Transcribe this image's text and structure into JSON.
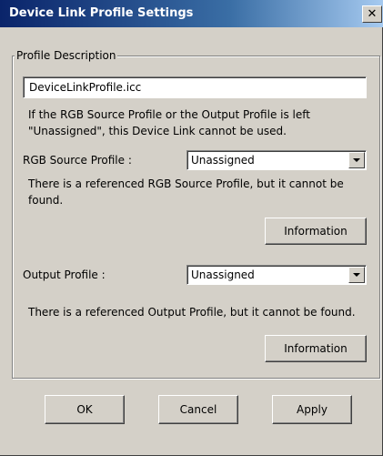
{
  "window": {
    "title": "Device Link Profile Settings",
    "close_glyph": "✕"
  },
  "group": {
    "legend": "Profile Description"
  },
  "description": {
    "value": "DeviceLinkProfile.icc"
  },
  "notes": {
    "unassigned_line1": "If the RGB Source Profile or the Output Profile is left",
    "unassigned_line2": "\"Unassigned\", this Device Link cannot be used."
  },
  "rgb_source": {
    "label": "RGB Source Profile :",
    "selected": "Unassigned",
    "warning_line1": "There is a referenced RGB Source Profile, but it cannot be",
    "warning_line2": "found.",
    "info_button": "Information"
  },
  "output": {
    "label": "Output Profile :",
    "selected": "Unassigned",
    "warning": "There is a referenced Output Profile, but it cannot be found.",
    "info_button": "Information"
  },
  "footer": {
    "ok": "OK",
    "cancel": "Cancel",
    "apply": "Apply"
  },
  "icons": {
    "close": "close-icon",
    "dropdown": "chevron-down-icon"
  }
}
